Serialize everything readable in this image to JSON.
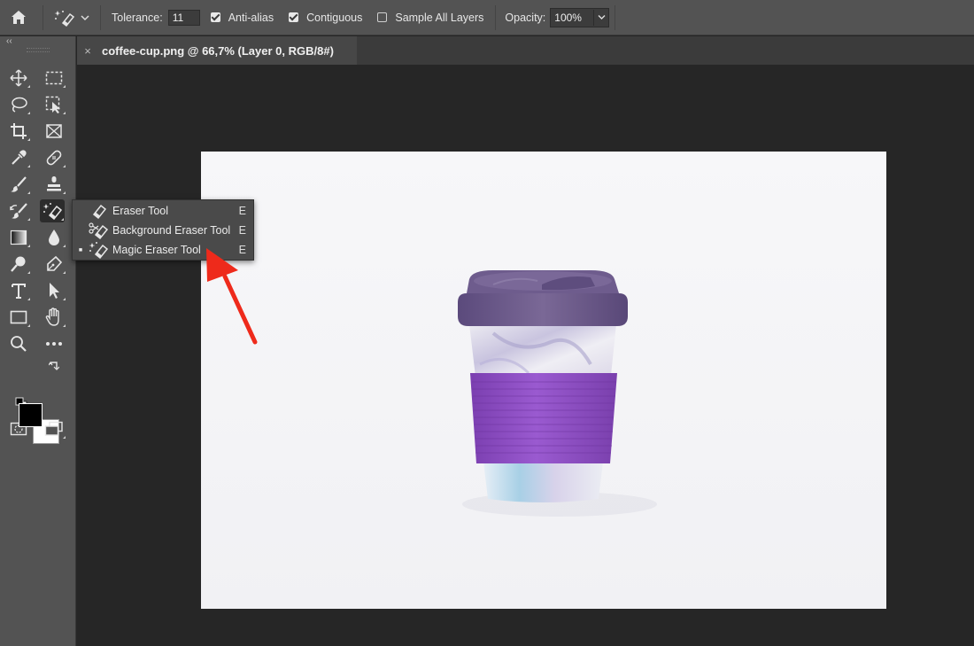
{
  "options_bar": {
    "home_icon": "home-icon",
    "tool_icon": "magic-eraser-icon",
    "tolerance_label": "Tolerance:",
    "tolerance_value": "11",
    "anti_alias_label": "Anti-alias",
    "anti_alias_checked": true,
    "contiguous_label": "Contiguous",
    "contiguous_checked": true,
    "sample_all_layers_label": "Sample All Layers",
    "sample_all_layers_checked": false,
    "opacity_label": "Opacity:",
    "opacity_value": "100%"
  },
  "tools_panel": {
    "collapse_label": "‹‹",
    "foreground_color": "#000000",
    "background_color": "#ffffff"
  },
  "document_tab": {
    "close_label": "×",
    "title": "coffee-cup.png @ 66,7% (Layer 0, RGB/8#)"
  },
  "eraser_flyout": {
    "items": [
      {
        "label": "Eraser Tool",
        "shortcut": "E",
        "selected": false,
        "icon": "eraser-icon"
      },
      {
        "label": "Background Eraser Tool",
        "shortcut": "E",
        "selected": false,
        "icon": "background-eraser-icon"
      },
      {
        "label": "Magic Eraser Tool",
        "shortcut": "E",
        "selected": true,
        "icon": "magic-eraser-icon"
      }
    ],
    "selected_bullet": "■"
  },
  "canvas_image": {
    "subject": "coffee-cup",
    "lid_color": "#6b5a8a",
    "sleeve_color": "#8a4bbf",
    "background_color": "#f8f8fa"
  },
  "annotation": {
    "arrow_color": "#ee2a1b"
  }
}
